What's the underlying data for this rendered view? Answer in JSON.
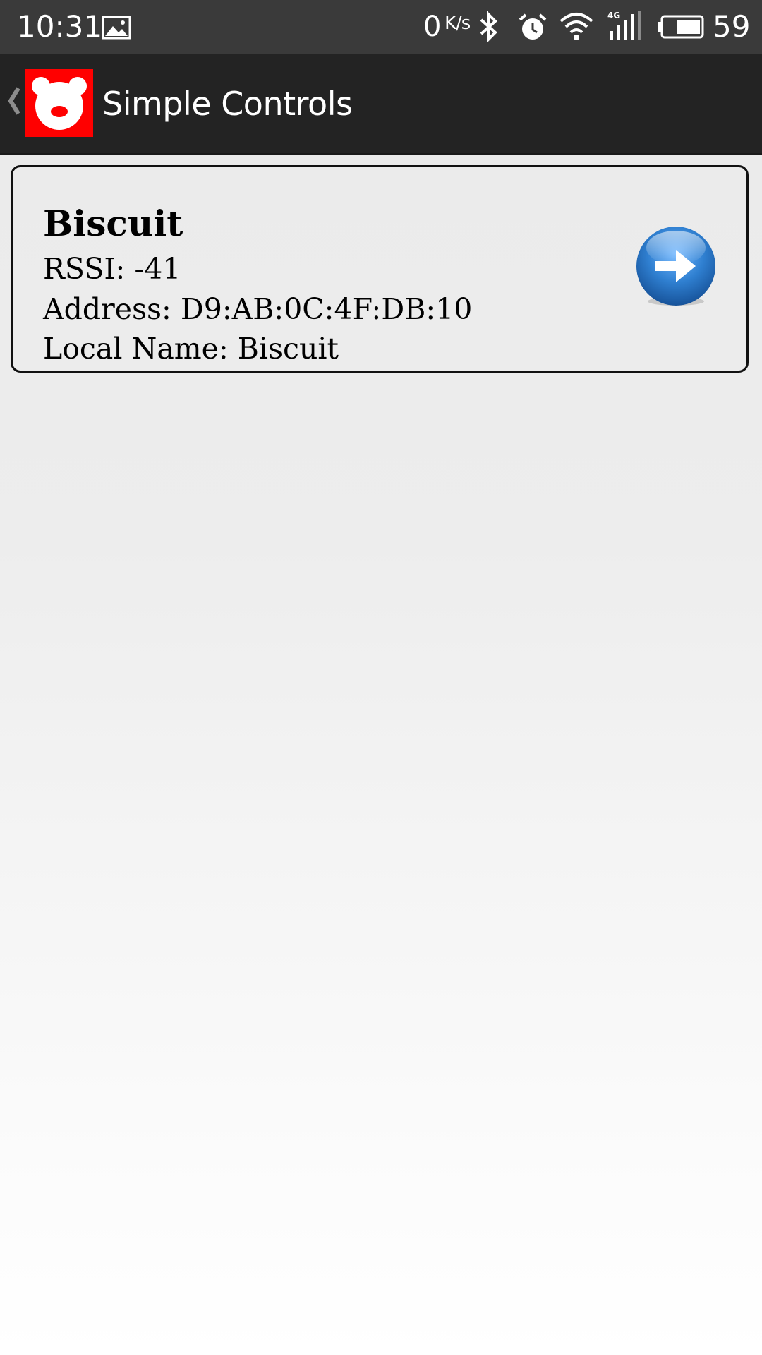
{
  "status_bar": {
    "time": "10:31",
    "net_speed_value": "0",
    "net_speed_unit": "K/s",
    "battery_level": "59",
    "icons": [
      "gallery-icon",
      "bluetooth-icon",
      "alarm-icon",
      "wifi-icon",
      "signal-4g-icon",
      "battery-icon"
    ]
  },
  "action_bar": {
    "title": "Simple Controls",
    "icons": [
      "back-chevron-icon",
      "app-logo-bear-icon"
    ]
  },
  "device_list": {
    "items": [
      {
        "name": "Biscuit",
        "rssi_line": "RSSI: -41",
        "address_line": "Address: D9:AB:0C:4F:DB:10",
        "local_name_line": "Local Name: Biscuit",
        "action_icon": "arrow-right-circle-icon"
      }
    ]
  },
  "colors": {
    "status_bar_bg": "#3a3a3a",
    "action_bar_bg": "#232323",
    "logo_bg": "#ff0000",
    "arrow_button": "#2f7fd0"
  }
}
